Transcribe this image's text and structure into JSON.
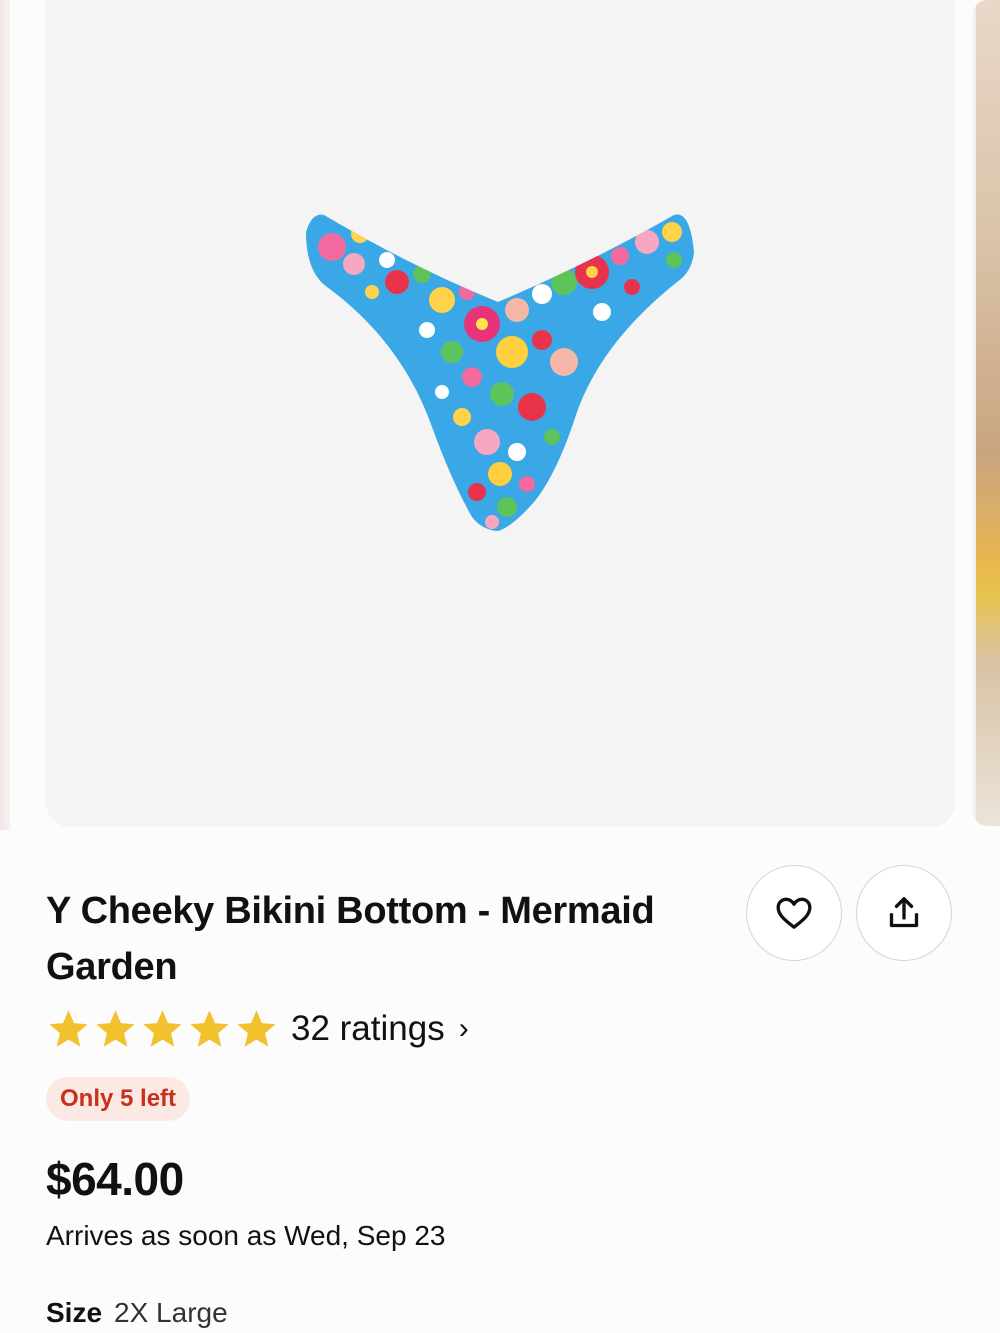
{
  "product": {
    "title": "Y Cheeky Bikini Bottom - Mermaid Garden",
    "image": {
      "kind": "product-photo",
      "colors": {
        "background": "#f4f4f4",
        "base": "#3aa8e6"
      }
    },
    "rating": {
      "stars": 5,
      "max_stars": 5,
      "star_color": "#f2c12e",
      "ratings_text": "32 ratings",
      "chevron": "›"
    },
    "stock_badge": {
      "text": "Only 5 left",
      "text_color": "#c8301c",
      "background": "#fde9e4"
    },
    "price": "$64.00",
    "delivery": "Arrives as soon as Wed, Sep 23",
    "size": {
      "label": "Size",
      "value": "2X Large"
    }
  },
  "actions": {
    "favorite_icon": "heart-icon",
    "share_icon": "share-upload-icon"
  }
}
